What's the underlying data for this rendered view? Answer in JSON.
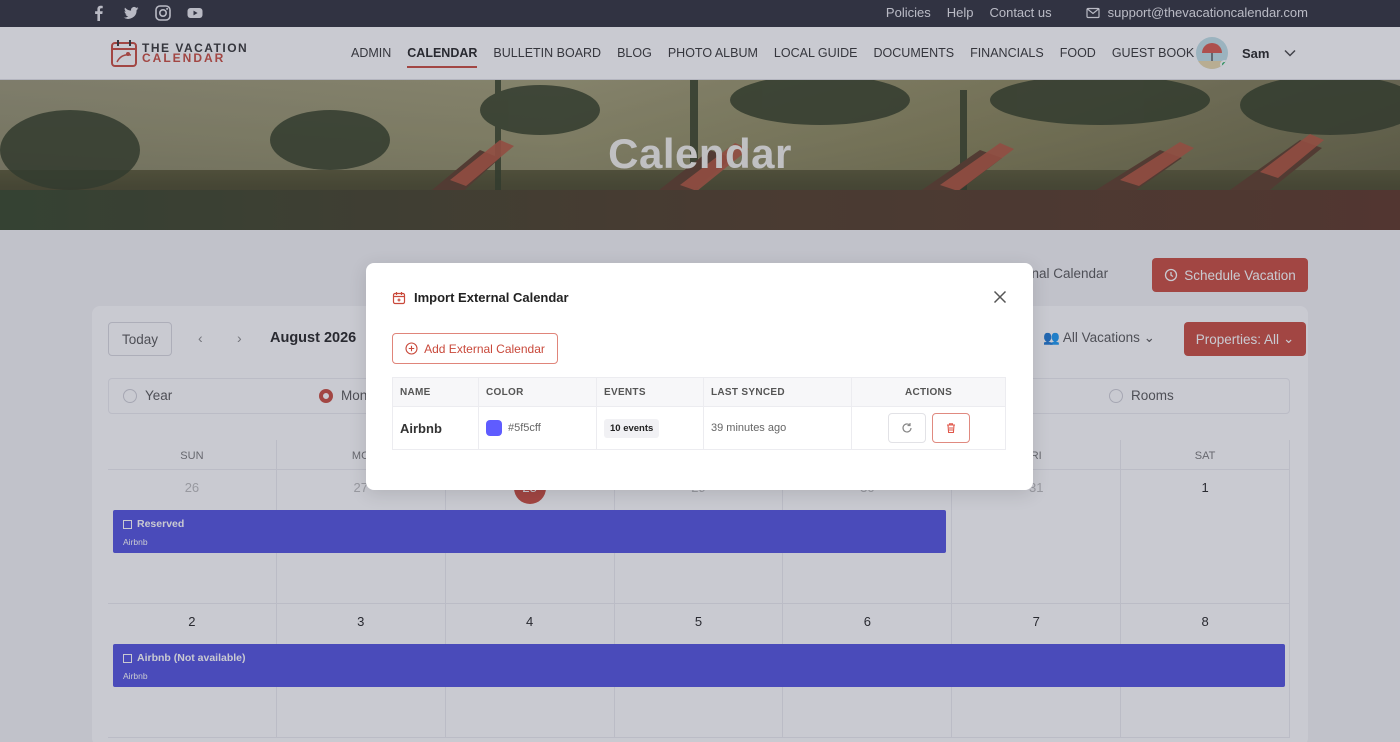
{
  "topbar": {
    "links": [
      "Policies",
      "Help",
      "Contact us"
    ],
    "email": "support@thevacationcalendar.com",
    "social_icons": [
      "facebook-icon",
      "twitter-icon",
      "instagram-icon",
      "youtube-icon"
    ]
  },
  "brand": {
    "line1": "THE VACATION",
    "line2": "CALENDAR"
  },
  "nav": {
    "items": [
      "ADMIN",
      "CALENDAR",
      "BULLETIN BOARD",
      "BLOG",
      "PHOTO ALBUM",
      "LOCAL GUIDE",
      "DOCUMENTS",
      "FINANCIALS",
      "FOOD",
      "GUEST BOOK"
    ],
    "active": "CALENDAR"
  },
  "user": {
    "name": "Sam"
  },
  "hero": {
    "title": "Calendar"
  },
  "actions": {
    "import_link": "External Calendar",
    "schedule_button": "Schedule Vacation"
  },
  "toolbar": {
    "today": "Today",
    "month": "August 2026",
    "vacations_filter": "All Vacations",
    "properties_filter": "Properties: All"
  },
  "views": {
    "year": "Year",
    "month": "Mon",
    "rooms": "Rooms"
  },
  "calendar": {
    "days_of_week": [
      "SUN",
      "MO",
      "",
      "",
      "",
      "RI",
      "SAT"
    ],
    "week1": [
      "26",
      "27",
      "28",
      "29",
      "30",
      "31",
      "1"
    ],
    "week2": [
      "2",
      "3",
      "4",
      "5",
      "6",
      "7",
      "8"
    ],
    "events": [
      {
        "title": "Reserved",
        "source": "Airbnb"
      },
      {
        "title": "Airbnb (Not available)",
        "source": "Airbnb"
      }
    ]
  },
  "modal": {
    "title": "Import External Calendar",
    "add_button": "Add External Calendar",
    "columns": [
      "NAME",
      "COLOR",
      "EVENTS",
      "LAST SYNCED",
      "ACTIONS"
    ],
    "rows": [
      {
        "name": "Airbnb",
        "color": "#5f5cff",
        "color_label": "#5f5cff",
        "events": "10 events",
        "last_synced": "39 minutes ago"
      }
    ]
  },
  "colors": {
    "accent": "#c9493b",
    "event": "#4f4fe0",
    "topbar": "#2d2f3a"
  }
}
